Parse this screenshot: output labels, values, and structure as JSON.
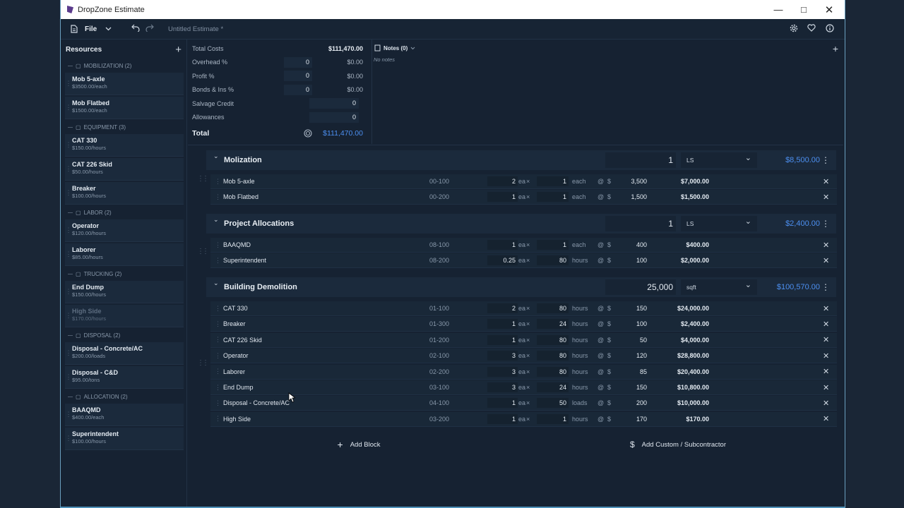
{
  "window": {
    "title": "DropZone Estimate"
  },
  "menubar": {
    "file_label": "File",
    "doc_title": "Untitled Estimate *"
  },
  "sidebar": {
    "title": "Resources",
    "groups": [
      {
        "label": "MOBILIZATION (2)",
        "items": [
          {
            "name": "Mob 5-axle",
            "price": "$3500.00/each"
          },
          {
            "name": "Mob Flatbed",
            "price": "$1500.00/each"
          }
        ]
      },
      {
        "label": "EQUIPMENT (3)",
        "items": [
          {
            "name": "CAT 330",
            "price": "$150.00/hours"
          },
          {
            "name": "CAT 226 Skid",
            "price": "$50.00/hours"
          },
          {
            "name": "Breaker",
            "price": "$100.00/hours"
          }
        ]
      },
      {
        "label": "LABOR (2)",
        "items": [
          {
            "name": "Operator",
            "price": "$120.00/hours"
          },
          {
            "name": "Laborer",
            "price": "$85.00/hours"
          }
        ]
      },
      {
        "label": "TRUCKING (2)",
        "items": [
          {
            "name": "End Dump",
            "price": "$150.00/hours"
          },
          {
            "name": "High Side",
            "price": "$170.00/hours"
          }
        ]
      },
      {
        "label": "DISPOSAL (2)",
        "items": [
          {
            "name": "Disposal - Concrete/AC",
            "price": "$200.00/loads"
          },
          {
            "name": "Disposal - C&D",
            "price": "$95.00/tons"
          }
        ]
      },
      {
        "label": "ALLOCATION (2)",
        "items": [
          {
            "name": "BAAQMD",
            "price": "$400.00/each"
          },
          {
            "name": "Superintendent",
            "price": "$100.00/hours"
          }
        ]
      }
    ]
  },
  "summary": {
    "total_costs_label": "Total Costs",
    "total_costs": "$111,470.00",
    "overhead_label": "Overhead %",
    "overhead_pct": "0",
    "overhead_amt": "$0.00",
    "profit_label": "Profit %",
    "profit_pct": "0",
    "profit_amt": "$0.00",
    "bonds_label": "Bonds & Ins %",
    "bonds_pct": "0",
    "bonds_amt": "$0.00",
    "salvage_label": "Salvage Credit",
    "salvage": "0",
    "allowances_label": "Allowances",
    "allowances": "0",
    "total_label": "Total",
    "total": "$111,470.00"
  },
  "notes": {
    "label": "Notes (0)",
    "empty": "No notes"
  },
  "blocks": [
    {
      "title": "Molization",
      "qty": "1",
      "unit": "LS",
      "total": "$8,500.00",
      "lines": [
        {
          "name": "Mob 5-axle",
          "code": "00-100",
          "q": "2",
          "ea": "ea",
          "d": "1",
          "du": "each",
          "rate": "3,500",
          "total": "$7,000.00"
        },
        {
          "name": "Mob Flatbed",
          "code": "00-200",
          "q": "1",
          "ea": "ea",
          "d": "1",
          "du": "each",
          "rate": "1,500",
          "total": "$1,500.00"
        }
      ]
    },
    {
      "title": "Project Allocations",
      "qty": "1",
      "unit": "LS",
      "total": "$2,400.00",
      "lines": [
        {
          "name": "BAAQMD",
          "code": "08-100",
          "q": "1",
          "ea": "ea",
          "d": "1",
          "du": "each",
          "rate": "400",
          "total": "$400.00"
        },
        {
          "name": "Superintendent",
          "code": "08-200",
          "q": "0.25",
          "ea": "ea",
          "d": "80",
          "du": "hours",
          "rate": "100",
          "total": "$2,000.00"
        }
      ]
    },
    {
      "title": "Building Demolition",
      "qty": "25,000",
      "unit": "sqft",
      "total": "$100,570.00",
      "lines": [
        {
          "name": "CAT 330",
          "code": "01-100",
          "q": "2",
          "ea": "ea",
          "d": "80",
          "du": "hours",
          "rate": "150",
          "total": "$24,000.00"
        },
        {
          "name": "Breaker",
          "code": "01-300",
          "q": "1",
          "ea": "ea",
          "d": "24",
          "du": "hours",
          "rate": "100",
          "total": "$2,400.00"
        },
        {
          "name": "CAT 226 Skid",
          "code": "01-200",
          "q": "1",
          "ea": "ea",
          "d": "80",
          "du": "hours",
          "rate": "50",
          "total": "$4,000.00"
        },
        {
          "name": "Operator",
          "code": "02-100",
          "q": "3",
          "ea": "ea",
          "d": "80",
          "du": "hours",
          "rate": "120",
          "total": "$28,800.00"
        },
        {
          "name": "Laborer",
          "code": "02-200",
          "q": "3",
          "ea": "ea",
          "d": "80",
          "du": "hours",
          "rate": "85",
          "total": "$20,400.00"
        },
        {
          "name": "End Dump",
          "code": "03-100",
          "q": "3",
          "ea": "ea",
          "d": "24",
          "du": "hours",
          "rate": "150",
          "total": "$10,800.00"
        },
        {
          "name": "Disposal - Concrete/AC",
          "code": "04-100",
          "q": "1",
          "ea": "ea",
          "d": "50",
          "du": "loads",
          "rate": "200",
          "total": "$10,000.00"
        },
        {
          "name": "High Side",
          "code": "03-200",
          "q": "1",
          "ea": "ea",
          "d": "1",
          "du": "hours",
          "rate": "170",
          "total": "$170.00"
        }
      ]
    }
  ],
  "footer": {
    "add_block": "Add Block",
    "add_custom": "Add Custom / Subcontractor"
  },
  "symbols": {
    "x": "×",
    "at": "@",
    "dollar": "$"
  },
  "colors": {
    "accent": "#4c8ff0",
    "bg": "#162232"
  }
}
